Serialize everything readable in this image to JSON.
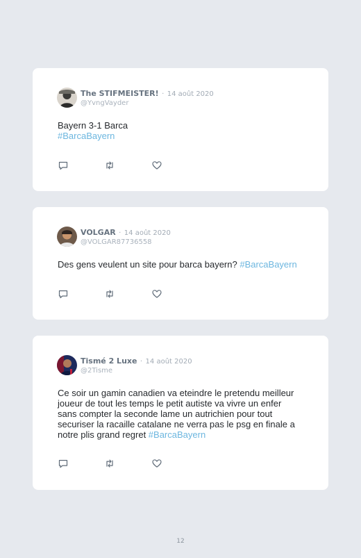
{
  "tweets": [
    {
      "name": "The STIFMEISTER!",
      "separator": "·",
      "date": "14 août 2020",
      "handle": "@YvngVayder",
      "text_lines": [
        "Bayern 3-1 Barca"
      ],
      "hashtag": "#BarcaBayern",
      "avatar_icon": "avatar-portrait-dark"
    },
    {
      "name": "VOLGAR",
      "separator": "·",
      "date": "14 août 2020",
      "handle": "@VOLGAR87736558",
      "text": "Des gens veulent un site pour barca bayern? ",
      "hashtag": "#BarcaBayern",
      "avatar_icon": "avatar-portrait-face"
    },
    {
      "name": "Tismé 2 Luxe",
      "separator": "·",
      "date": "14 août 2020",
      "handle": "@2Tisme",
      "text_lines": [
        "Ce soir un gamin canadien va eteindre le pretendu meilleur",
        "joueur de tout les temps le petit autiste va vivre un enfer",
        "sans compter la seconde lame un autrichien pour tout",
        "securiser la racaille catalane ne verra pas le psg en finale a",
        "notre plis grand regret "
      ],
      "hashtag": "#BarcaBayern",
      "avatar_icon": "avatar-portrait-team"
    }
  ],
  "action_icons": [
    "reply-icon",
    "retweet-icon",
    "like-icon"
  ],
  "colors": {
    "background": "#e6e9ee",
    "card": "#ffffff",
    "name": "#66727f",
    "meta": "#a2abb5",
    "text": "#26292d",
    "hashtag": "#6cb6df",
    "icon": "#5f6b78"
  },
  "page_number": "12"
}
